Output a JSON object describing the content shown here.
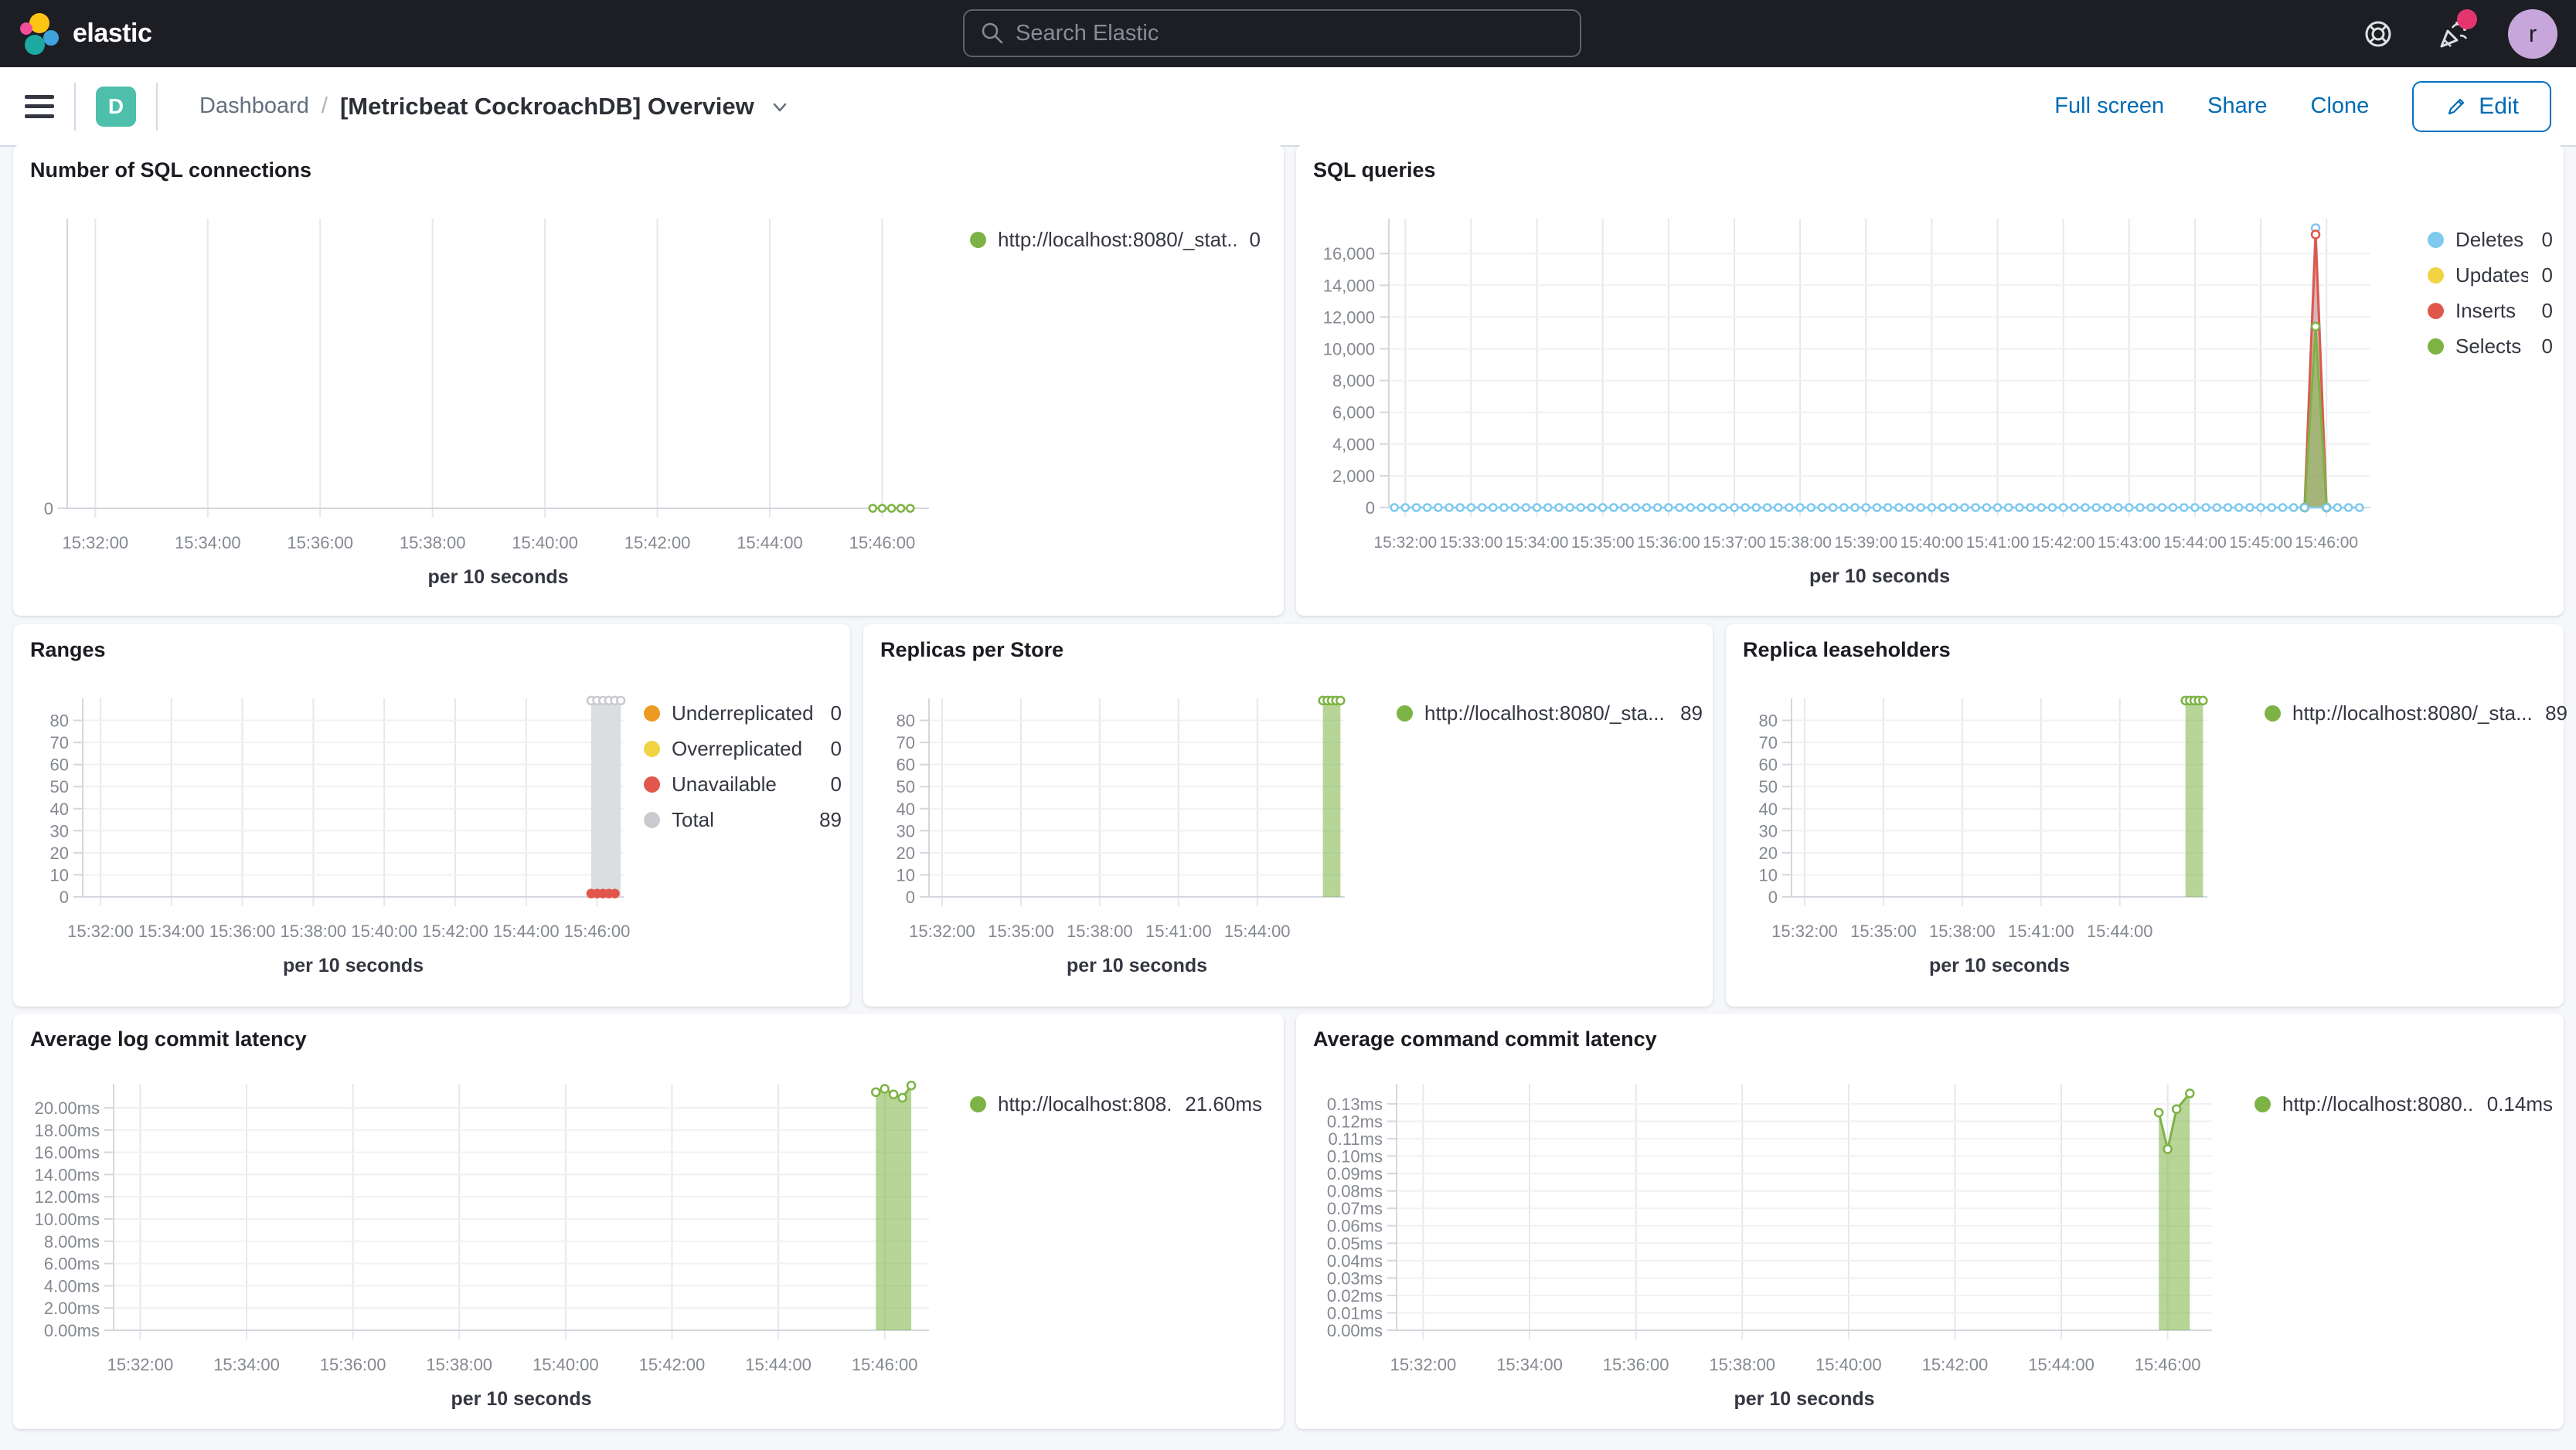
{
  "header": {
    "logo_text": "elastic",
    "search_placeholder": "Search Elastic",
    "avatar_initial": "r"
  },
  "nav": {
    "space_initial": "D",
    "breadcrumb_root": "Dashboard",
    "breadcrumb_separator": "/",
    "title": "[Metricbeat CockroachDB] Overview",
    "actions": {
      "full_screen": "Full screen",
      "share": "Share",
      "clone": "Clone",
      "edit": "Edit"
    }
  },
  "colors": {
    "green": "#7DB344",
    "green_fill": "rgba(124,179,66,0.55)",
    "blue": "#7FC9EF",
    "blue_fill": "rgba(127,201,239,0.35)",
    "yellow": "#F1D343",
    "red": "#E2574B",
    "red_fill": "rgba(226,87,75,0.35)",
    "orange": "#EC9A20",
    "gray": "#C9CBD1",
    "gray_fill": "#DBDDE1",
    "accent_blue": "#006BB4"
  },
  "panels": [
    {
      "title": "Number of SQL connections",
      "legend": [
        {
          "label": "http://localhost:8080/_stat...",
          "value": "0",
          "color": "#7DB344"
        }
      ]
    },
    {
      "title": "SQL queries",
      "legend": [
        {
          "label": "Deletes",
          "value": "0",
          "color": "#7FC9EF"
        },
        {
          "label": "Updates",
          "value": "0",
          "color": "#F1D343"
        },
        {
          "label": "Inserts",
          "value": "0",
          "color": "#E2574B"
        },
        {
          "label": "Selects",
          "value": "0",
          "color": "#7DB344"
        }
      ]
    },
    {
      "title": "Ranges",
      "legend": [
        {
          "label": "Underreplicated",
          "value": "0",
          "color": "#EC9A20"
        },
        {
          "label": "Overreplicated",
          "value": "0",
          "color": "#F1D343"
        },
        {
          "label": "Unavailable",
          "value": "0",
          "color": "#E2574B"
        },
        {
          "label": "Total",
          "value": "89",
          "color": "#C9CBD1"
        }
      ]
    },
    {
      "title": "Replicas per Store",
      "legend": [
        {
          "label": "http://localhost:8080/_sta...",
          "value": "89",
          "color": "#7DB344"
        }
      ]
    },
    {
      "title": "Replica leaseholders",
      "legend": [
        {
          "label": "http://localhost:8080/_sta...",
          "value": "89",
          "color": "#7DB344"
        }
      ]
    },
    {
      "title": "Average log commit latency",
      "legend": [
        {
          "label": "http://localhost:808...",
          "value": "21.60ms",
          "color": "#7DB344"
        }
      ]
    },
    {
      "title": "Average command commit latency",
      "legend": [
        {
          "label": "http://localhost:8080...",
          "value": "0.14ms",
          "color": "#7DB344"
        }
      ]
    }
  ],
  "chart_data": [
    {
      "type": "line",
      "title": "Number of SQL connections",
      "x_axis_label": "per 10 seconds",
      "x_domain": [
        "15:31:30",
        "15:46:50"
      ],
      "x_ticks": [
        "15:32:00",
        "15:34:00",
        "15:36:00",
        "15:38:00",
        "15:40:00",
        "15:42:00",
        "15:44:00",
        "15:46:00"
      ],
      "y_ticks": [
        {
          "v": 0,
          "label": "0"
        }
      ],
      "y_max": 8,
      "series": [
        {
          "name": "http://localhost:8080/_stat...",
          "render": "dotline",
          "color": "#7DB344",
          "points": [
            [
              "15:45:50",
              0
            ],
            [
              "15:46:00",
              0
            ],
            [
              "15:46:10",
              0
            ],
            [
              "15:46:20",
              0
            ],
            [
              "15:46:30",
              0
            ]
          ]
        }
      ]
    },
    {
      "type": "line",
      "title": "SQL queries",
      "x_axis_label": "per 10 seconds",
      "x_domain": [
        "15:31:45",
        "15:46:40"
      ],
      "x_ticks": [
        "15:32:00",
        "15:33:00",
        "15:34:00",
        "15:35:00",
        "15:36:00",
        "15:37:00",
        "15:38:00",
        "15:39:00",
        "15:40:00",
        "15:41:00",
        "15:42:00",
        "15:43:00",
        "15:44:00",
        "15:45:00",
        "15:46:00"
      ],
      "y_ticks": [
        {
          "v": 0,
          "label": "0"
        },
        {
          "v": 2000,
          "label": "2,000"
        },
        {
          "v": 4000,
          "label": "4,000"
        },
        {
          "v": 6000,
          "label": "6,000"
        },
        {
          "v": 8000,
          "label": "8,000"
        },
        {
          "v": 10000,
          "label": "10,000"
        },
        {
          "v": 12000,
          "label": "12,000"
        },
        {
          "v": 14000,
          "label": "14,000"
        },
        {
          "v": 16000,
          "label": "16,000"
        }
      ],
      "y_max": 18200,
      "series": [
        {
          "name": "Deletes",
          "render": "area",
          "color": "#7FC9EF",
          "fill": "rgba(127,201,239,0.35)",
          "points": [
            [
              "15:45:40",
              0
            ],
            [
              "15:45:50",
              17600
            ],
            [
              "15:46:00",
              0
            ]
          ]
        },
        {
          "name": "Inserts",
          "render": "area",
          "color": "#E2574B",
          "fill": "rgba(226,87,75,0.35)",
          "points": [
            [
              "15:45:40",
              0
            ],
            [
              "15:45:50",
              17200
            ],
            [
              "15:46:00",
              0
            ]
          ]
        },
        {
          "name": "Selects",
          "render": "area",
          "color": "#7DB344",
          "fill": "rgba(124,179,66,0.55)",
          "points": [
            [
              "15:45:40",
              0
            ],
            [
              "15:45:50",
              11400
            ],
            [
              "15:46:00",
              0
            ]
          ]
        },
        {
          "name": "Deletes",
          "render": "dotline",
          "color": "#7FC9EF",
          "const": {
            "value": 0,
            "start": "15:31:50",
            "end": "15:46:30",
            "step_s": 10,
            "skip": [
              "15:45:50"
            ]
          }
        },
        {
          "name": "Updates",
          "render": "none",
          "color": "#F1D343",
          "value": 0
        }
      ]
    },
    {
      "type": "area",
      "title": "Ranges",
      "x_axis_label": "per 10 seconds",
      "x_domain": [
        "15:31:30",
        "15:46:45"
      ],
      "x_ticks": [
        "15:32:00",
        "15:34:00",
        "15:36:00",
        "15:38:00",
        "15:40:00",
        "15:42:00",
        "15:44:00",
        "15:46:00"
      ],
      "y_ticks": [
        {
          "v": 0,
          "label": "0"
        },
        {
          "v": 10,
          "label": "10"
        },
        {
          "v": 20,
          "label": "20"
        },
        {
          "v": 30,
          "label": "30"
        },
        {
          "v": 40,
          "label": "40"
        },
        {
          "v": 50,
          "label": "50"
        },
        {
          "v": 60,
          "label": "60"
        },
        {
          "v": 70,
          "label": "70"
        },
        {
          "v": 80,
          "label": "80"
        }
      ],
      "y_max": 90,
      "series": [
        {
          "name": "Total",
          "render": "area",
          "color": "#C9CBD1",
          "fill": "#DBDDE1",
          "points": [
            [
              "15:45:50",
              89
            ],
            [
              "15:46:00",
              89
            ],
            [
              "15:46:10",
              89
            ],
            [
              "15:46:20",
              89
            ],
            [
              "15:46:30",
              89
            ],
            [
              "15:46:40",
              89
            ]
          ]
        },
        {
          "name": "Unavailable",
          "render": "dots",
          "color": "#E2574B",
          "points": [
            [
              "15:45:50",
              1.5
            ],
            [
              "15:46:00",
              1.5
            ],
            [
              "15:46:10",
              1.5
            ],
            [
              "15:46:20",
              1.5
            ],
            [
              "15:46:30",
              1.5
            ]
          ]
        }
      ]
    },
    {
      "type": "area",
      "title": "Replicas per Store",
      "x_axis_label": "per 10 seconds",
      "x_domain": [
        "15:31:30",
        "15:47:20"
      ],
      "x_ticks": [
        "15:32:00",
        "15:35:00",
        "15:38:00",
        "15:41:00",
        "15:44:00"
      ],
      "y_ticks": [
        {
          "v": 0,
          "label": "0"
        },
        {
          "v": 10,
          "label": "10"
        },
        {
          "v": 20,
          "label": "20"
        },
        {
          "v": 30,
          "label": "30"
        },
        {
          "v": 40,
          "label": "40"
        },
        {
          "v": 50,
          "label": "50"
        },
        {
          "v": 60,
          "label": "60"
        },
        {
          "v": 70,
          "label": "70"
        },
        {
          "v": 80,
          "label": "80"
        }
      ],
      "y_max": 90,
      "series": [
        {
          "name": "http://localhost:8080/_sta...",
          "render": "area",
          "color": "#7DB344",
          "fill": "rgba(124,179,66,0.55)",
          "points": [
            [
              "15:46:30",
              89
            ],
            [
              "15:46:40",
              89
            ],
            [
              "15:46:50",
              89
            ],
            [
              "15:47:00",
              89
            ],
            [
              "15:47:10",
              89
            ]
          ]
        }
      ]
    },
    {
      "type": "area",
      "title": "Replica leaseholders",
      "x_axis_label": "per 10 seconds",
      "x_domain": [
        "15:31:30",
        "15:47:20"
      ],
      "x_ticks": [
        "15:32:00",
        "15:35:00",
        "15:38:00",
        "15:41:00",
        "15:44:00"
      ],
      "y_ticks": [
        {
          "v": 0,
          "label": "0"
        },
        {
          "v": 10,
          "label": "10"
        },
        {
          "v": 20,
          "label": "20"
        },
        {
          "v": 30,
          "label": "30"
        },
        {
          "v": 40,
          "label": "40"
        },
        {
          "v": 50,
          "label": "50"
        },
        {
          "v": 60,
          "label": "60"
        },
        {
          "v": 70,
          "label": "70"
        },
        {
          "v": 80,
          "label": "80"
        }
      ],
      "y_max": 90,
      "series": [
        {
          "name": "http://localhost:8080/_sta...",
          "render": "area",
          "color": "#7DB344",
          "fill": "rgba(124,179,66,0.55)",
          "points": [
            [
              "15:46:30",
              89
            ],
            [
              "15:46:40",
              89
            ],
            [
              "15:46:50",
              89
            ],
            [
              "15:47:00",
              89
            ],
            [
              "15:47:10",
              89
            ]
          ]
        }
      ]
    },
    {
      "type": "area",
      "title": "Average log commit latency",
      "x_axis_label": "per 10 seconds",
      "x_domain": [
        "15:31:30",
        "15:46:50"
      ],
      "x_ticks": [
        "15:32:00",
        "15:34:00",
        "15:36:00",
        "15:38:00",
        "15:40:00",
        "15:42:00",
        "15:44:00",
        "15:46:00"
      ],
      "y_ticks": [
        {
          "v": 0,
          "label": "0.00ms"
        },
        {
          "v": 2,
          "label": "2.00ms"
        },
        {
          "v": 4,
          "label": "4.00ms"
        },
        {
          "v": 6,
          "label": "6.00ms"
        },
        {
          "v": 8,
          "label": "8.00ms"
        },
        {
          "v": 10,
          "label": "10.00ms"
        },
        {
          "v": 12,
          "label": "12.00ms"
        },
        {
          "v": 14,
          "label": "14.00ms"
        },
        {
          "v": 16,
          "label": "16.00ms"
        },
        {
          "v": 18,
          "label": "18.00ms"
        },
        {
          "v": 20,
          "label": "20.00ms"
        }
      ],
      "y_max": 22.15,
      "series": [
        {
          "name": "http://localhost:808...",
          "render": "area",
          "color": "#7DB344",
          "fill": "rgba(124,179,66,0.55)",
          "points": [
            [
              "15:45:50",
              21.4
            ],
            [
              "15:46:00",
              21.7
            ],
            [
              "15:46:10",
              21.2
            ],
            [
              "15:46:20",
              20.9
            ],
            [
              "15:46:30",
              22.0
            ]
          ]
        }
      ]
    },
    {
      "type": "area",
      "title": "Average command commit latency",
      "x_axis_label": "per 10 seconds",
      "x_domain": [
        "15:31:30",
        "15:46:50"
      ],
      "x_ticks": [
        "15:32:00",
        "15:34:00",
        "15:36:00",
        "15:38:00",
        "15:40:00",
        "15:42:00",
        "15:44:00",
        "15:46:00"
      ],
      "y_ticks": [
        {
          "v": 0,
          "label": "0.00ms"
        },
        {
          "v": 0.01,
          "label": "0.01ms"
        },
        {
          "v": 0.02,
          "label": "0.02ms"
        },
        {
          "v": 0.03,
          "label": "0.03ms"
        },
        {
          "v": 0.04,
          "label": "0.04ms"
        },
        {
          "v": 0.05,
          "label": "0.05ms"
        },
        {
          "v": 0.06,
          "label": "0.06ms"
        },
        {
          "v": 0.07,
          "label": "0.07ms"
        },
        {
          "v": 0.08,
          "label": "0.08ms"
        },
        {
          "v": 0.09,
          "label": "0.09ms"
        },
        {
          "v": 0.1,
          "label": "0.10ms"
        },
        {
          "v": 0.11,
          "label": "0.11ms"
        },
        {
          "v": 0.12,
          "label": "0.12ms"
        },
        {
          "v": 0.13,
          "label": "0.13ms"
        }
      ],
      "y_max": 0.1415,
      "series": [
        {
          "name": "http://localhost:8080...",
          "render": "area",
          "color": "#7DB344",
          "fill": "rgba(124,179,66,0.55)",
          "points": [
            [
              "15:45:50",
              0.125
            ],
            [
              "15:46:00",
              0.104
            ],
            [
              "15:46:10",
              0.127
            ],
            [
              "15:46:25",
              0.136
            ]
          ]
        }
      ]
    }
  ]
}
